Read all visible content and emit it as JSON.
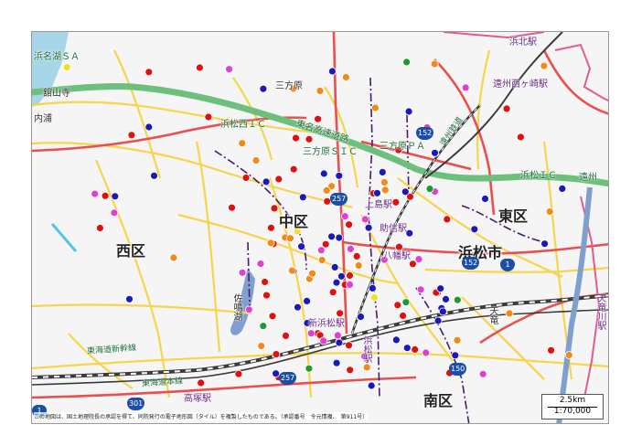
{
  "map": {
    "ward_labels": {
      "nishi": "西区",
      "naka": "中区",
      "higashi": "東区",
      "minami": "南区",
      "city": "浜松市"
    },
    "place_labels": {
      "mikatahara": "三方原",
      "uchiura": "内浦",
      "sanaruko": "佐鳴湖",
      "hamana_sa": "浜名湖ＳＡ",
      "mikatahara_pa": "三方原ＰＡ",
      "mikatahara_sic": "三方原ＳＩＣ",
      "hamamatsu_nishi_ic": "浜松西ＩＣ",
      "hamamatsu_ic": "浜松ＩＣ",
      "tomei": "東名高速道路",
      "shinkansen": "東海道新幹線",
      "tokaido_line": "東海道本線",
      "enshu_railway": "遠州鉄道",
      "kamijima_st": "上島駅",
      "sukenobu_st": "助信駅",
      "hachiman_st": "八幡駅",
      "shin_hamamatsu_st": "新浜松駅",
      "hamakita_st": "浜北駅",
      "saginosaka_st": "遠州西ヶ崎駅",
      "takatsuka_st": "高塚駅",
      "kanzanji": "舘山寺",
      "toyoda_st": "天竜川駅",
      "hamamatsu_st": "浜松駅",
      "tenryu": "天竜",
      "enshu": "遠州"
    },
    "route_shields": [
      "152",
      "257",
      "152",
      "1",
      "257",
      "150",
      "301",
      "1"
    ],
    "credit": "この地図は、国土地理院長の承認を得て、同院発行の電子地形図（タイル）を複製したものである。（承認番号　令元情複、　第911号）",
    "scale": {
      "distance_label": "2.5km",
      "ratio_label": "1:70,000"
    },
    "colors": {
      "background": "#f4f4f4",
      "expressway": "#6cc07c",
      "national_road": "#e94f4f",
      "prefectural_road": "#f6d54a",
      "ward_boundary": "#4a1a6b",
      "railway": "#3b3b3b",
      "lake": "#7f9fce",
      "marker_red": "#e01010",
      "marker_blue": "#1a1ab8",
      "marker_orange": "#f08a1a",
      "marker_magenta": "#e040d0",
      "marker_green": "#1e9a2e",
      "marker_yellow": "#f0e020"
    },
    "marker_groups": [
      {
        "category": "red",
        "count": 52
      },
      {
        "category": "blue",
        "count": 46
      },
      {
        "category": "orange",
        "count": 27
      },
      {
        "category": "magenta",
        "count": 23
      },
      {
        "category": "green",
        "count": 6
      },
      {
        "category": "yellow",
        "count": 3
      }
    ]
  }
}
